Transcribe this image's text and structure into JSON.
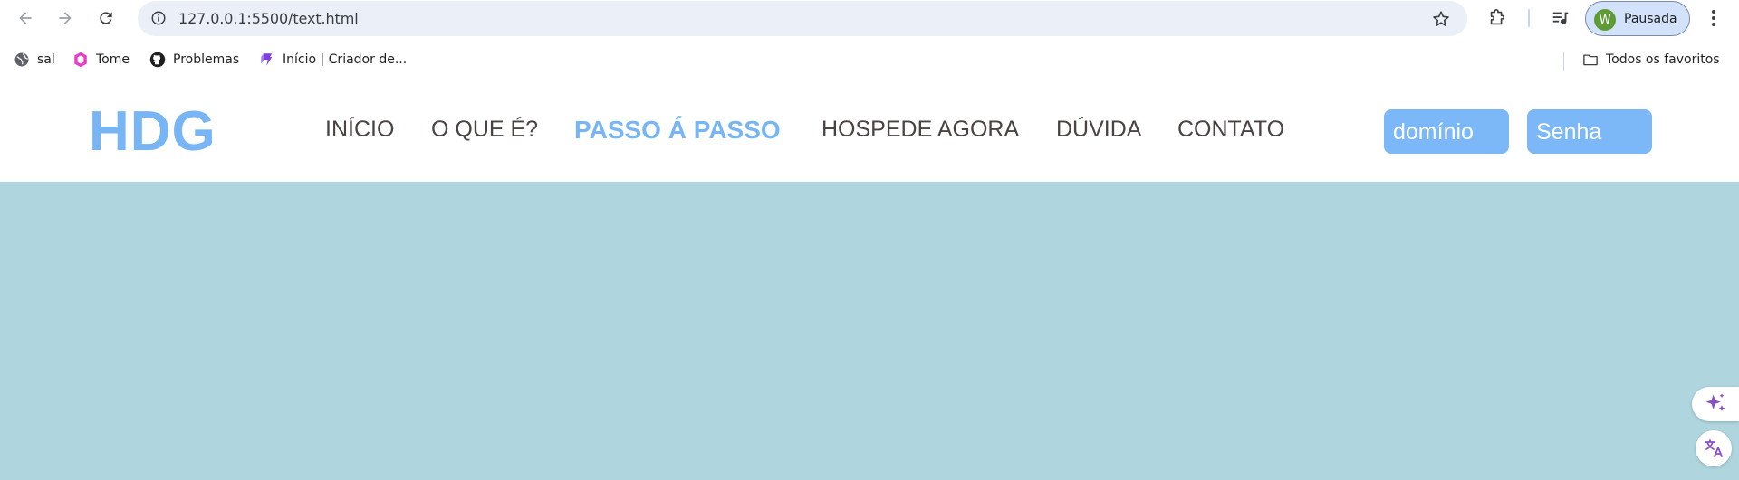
{
  "browser": {
    "url": "127.0.0.1:5500/text.html",
    "profile": {
      "initial": "W",
      "label": "Pausada",
      "avatar_color": "#5e9b37"
    },
    "bookmarks": [
      {
        "label": "sal",
        "icon": "globe-icon"
      },
      {
        "label": "Tome",
        "icon": "tome-icon"
      },
      {
        "label": "Problemas",
        "icon": "github-icon"
      },
      {
        "label": "Início | Criador de...",
        "icon": "creator-icon"
      }
    ],
    "all_bookmarks_label": "Todos os favoritos"
  },
  "site": {
    "logo": "HDG",
    "menu": [
      {
        "label": "INÍCIO",
        "active": false
      },
      {
        "label": "O QUE É?",
        "active": false
      },
      {
        "label": "PASSO Á PASSO",
        "active": true
      },
      {
        "label": "HOSPEDE AGORA",
        "active": false
      },
      {
        "label": "DÚVIDA",
        "active": false
      },
      {
        "label": "CONTATO",
        "active": false
      }
    ],
    "domain_input": {
      "placeholder": "domínio"
    },
    "password_input": {
      "placeholder": "Senha"
    }
  },
  "colors": {
    "accent": "#78b5f5",
    "menu_text": "#4a4342",
    "hero_bg": "#afd5df",
    "input_bg": "#7cb8f7"
  }
}
